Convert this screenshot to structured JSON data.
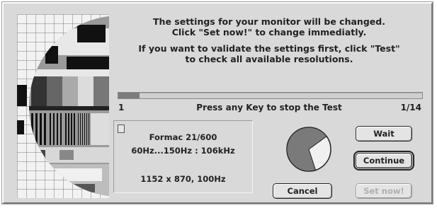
{
  "message": {
    "line1": "The settings for your monitor will be changed.",
    "line2": "Click \"Set now!\" to change immediatly.",
    "line3": "If you want to validate the settings first, click \"Test\"",
    "line4": "to check all available resolutions."
  },
  "progress": {
    "start": "1",
    "label": "Press any Key to stop the Test",
    "count": "1/14",
    "fraction": 0.071
  },
  "monitor": {
    "name": "Formac 21/600",
    "frequency_range": "60Hz...150Hz : 106kHz",
    "resolution": "1152 x 870, 100Hz"
  },
  "countdown": {
    "remaining_fraction": 0.7
  },
  "buttons": {
    "wait": "Wait",
    "continue": "Continue",
    "cancel": "Cancel",
    "set_now": "Set now!"
  }
}
